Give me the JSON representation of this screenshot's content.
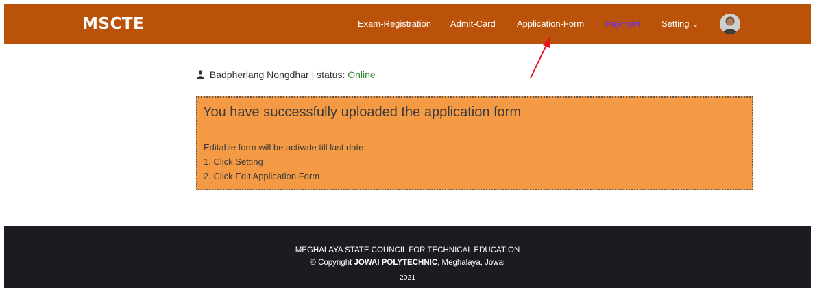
{
  "navbar": {
    "brand": "MSCTE",
    "links": {
      "exam_registration": "Exam-Registration",
      "admit_card": "Admit-Card",
      "application_form": "Application-Form",
      "payment": "Payment",
      "setting": "Setting"
    },
    "colors": {
      "background": "#bb5209",
      "payment_link": "#6a2bff"
    }
  },
  "user": {
    "name": "Badpherlang Nongdhar",
    "separator": "|",
    "status_label": "status:",
    "status_value": "Online"
  },
  "alert": {
    "title": "You have successfully uploaded the application form",
    "line1": "Editable form will be activate till last date.",
    "line2": "1. Click Setting",
    "line3": "2. Click Edit Application Form",
    "colors": {
      "background": "#f59a44"
    }
  },
  "footer": {
    "line1": "MEGHALAYA STATE COUNCIL FOR TECHNICAL EDUCATION",
    "copyright_prefix": "© Copyright",
    "institution": "JOWAI POLYTECHNIC",
    "location": ", Meghalaya, Jowai",
    "year": "2021"
  },
  "annotation": {
    "icon": "red-arrow-icon",
    "color": "#e8121b"
  }
}
